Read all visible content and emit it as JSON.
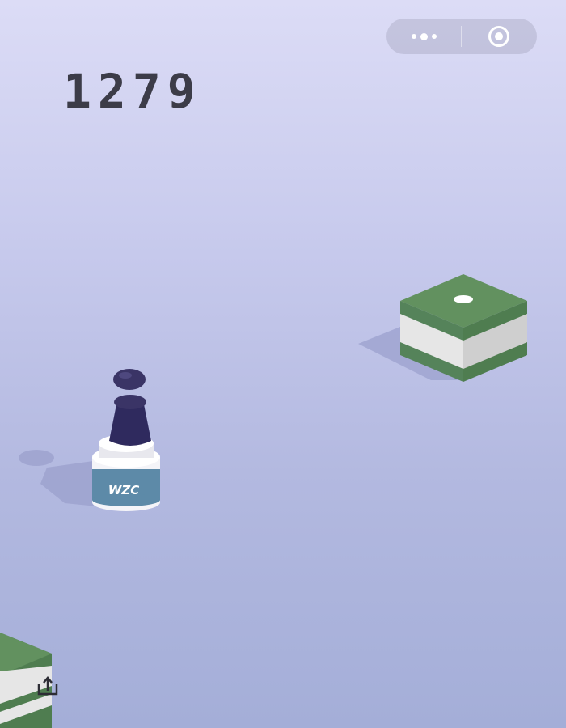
{
  "hud": {
    "score": "1279",
    "more_icon": "more-dots-icon",
    "close_icon": "target-circle-icon",
    "share_icon": "share-icon"
  },
  "player": {
    "label": "WZC",
    "head_color": "#3a3466",
    "body_color": "#2f2a5e"
  },
  "platforms": {
    "current": {
      "label": "WZC",
      "band_color": "#5d8aa8",
      "white_color": "#ffffff"
    },
    "target": {
      "top_color": "#5e8f5e",
      "side_color": "#4f7d50",
      "stripe_color": "#e6e6e6"
    }
  },
  "colors": {
    "bg_top": "#dcdcf6",
    "bg_bottom": "#a4aed8",
    "shadow": "#9ea3cf"
  }
}
